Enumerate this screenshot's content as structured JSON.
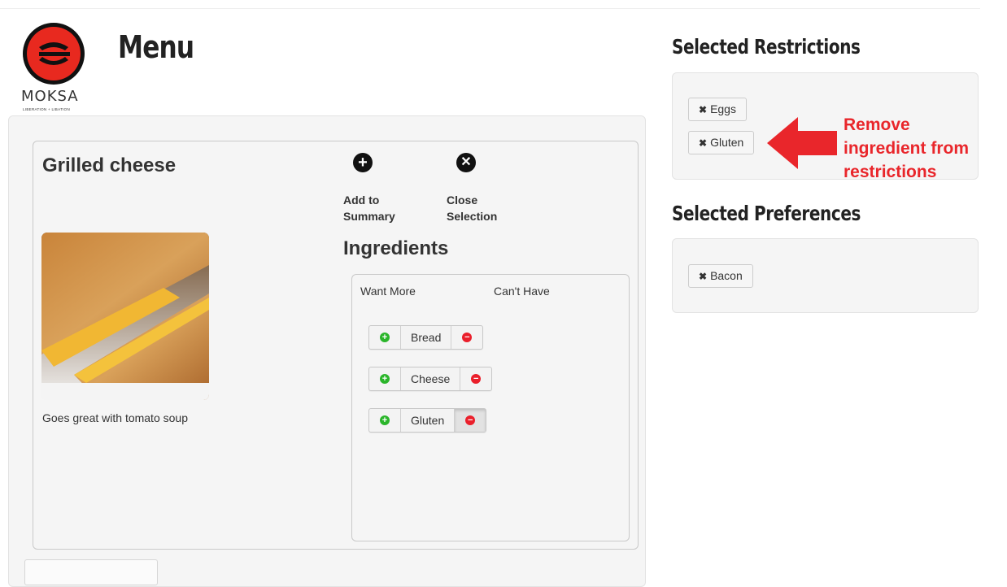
{
  "brand": {
    "name": "MOKSA",
    "tagline": "LIBERATION + LIBATION"
  },
  "page": {
    "title": "Menu"
  },
  "item": {
    "title": "Grilled cheese",
    "description": "Goes great with tomato soup",
    "actions": {
      "add_label_1": "Add to",
      "add_label_2": "Summary",
      "close_label_1": "Close",
      "close_label_2": "Selection"
    }
  },
  "ingredients": {
    "title": "Ingredients",
    "col_want_more": "Want More",
    "col_cant_have": "Can't Have",
    "items": [
      {
        "name": "Bread",
        "cant_have": false
      },
      {
        "name": "Cheese",
        "cant_have": false
      },
      {
        "name": "Gluten",
        "cant_have": true
      }
    ]
  },
  "restrictions": {
    "heading": "Selected Restrictions",
    "tags": [
      "Eggs",
      "Gluten"
    ]
  },
  "preferences": {
    "heading": "Selected Preferences",
    "tags": [
      "Bacon"
    ]
  },
  "annotation": {
    "line1": "Remove",
    "line2": "ingredient from",
    "line3": "restrictions"
  },
  "colors": {
    "accent_red": "#e9262b",
    "plus_green": "#2ab52a"
  },
  "icons": [
    "plus-circle-icon",
    "x-circle-icon",
    "minus-circle-icon",
    "x-icon",
    "arrow-left-icon"
  ]
}
